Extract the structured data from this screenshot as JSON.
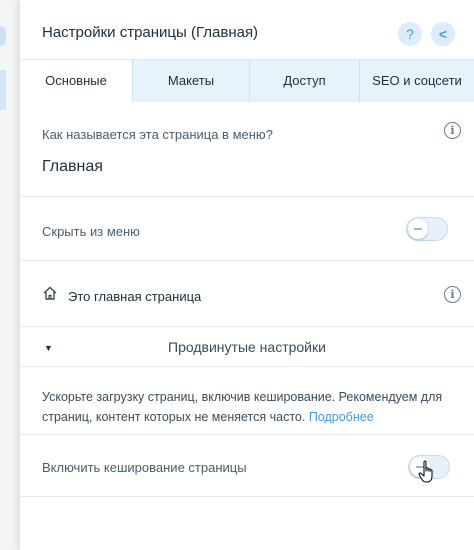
{
  "header": {
    "title": "Настройки страницы (Главная)",
    "help_label": "?",
    "back_label": "<"
  },
  "tabs": [
    {
      "label": "Основные",
      "active": true
    },
    {
      "label": "Макеты",
      "active": false
    },
    {
      "label": "Доступ",
      "active": false
    },
    {
      "label": "SEO и соцсети",
      "active": false
    }
  ],
  "page_name": {
    "question": "Как называется эта страница в меню?",
    "value": "Главная"
  },
  "hide_from_menu": {
    "label": "Скрыть из меню",
    "enabled": false
  },
  "home_page": {
    "label": "Это главная страница",
    "icon": "home-icon"
  },
  "advanced": {
    "label": "Продвинутые настройки",
    "expanded": true
  },
  "caching": {
    "description": "Ускорьте загрузку страниц, включив кеширование. Рекомендуем для страниц, контент которых не меняется часто.",
    "link_label": "Подробнее",
    "toggle_label": "Включить кеширование страницы",
    "enabled": false
  },
  "colors": {
    "accent": "#3d9bea",
    "tab_inactive_bg": "#e7f2fb",
    "text_dark": "#20303c"
  }
}
